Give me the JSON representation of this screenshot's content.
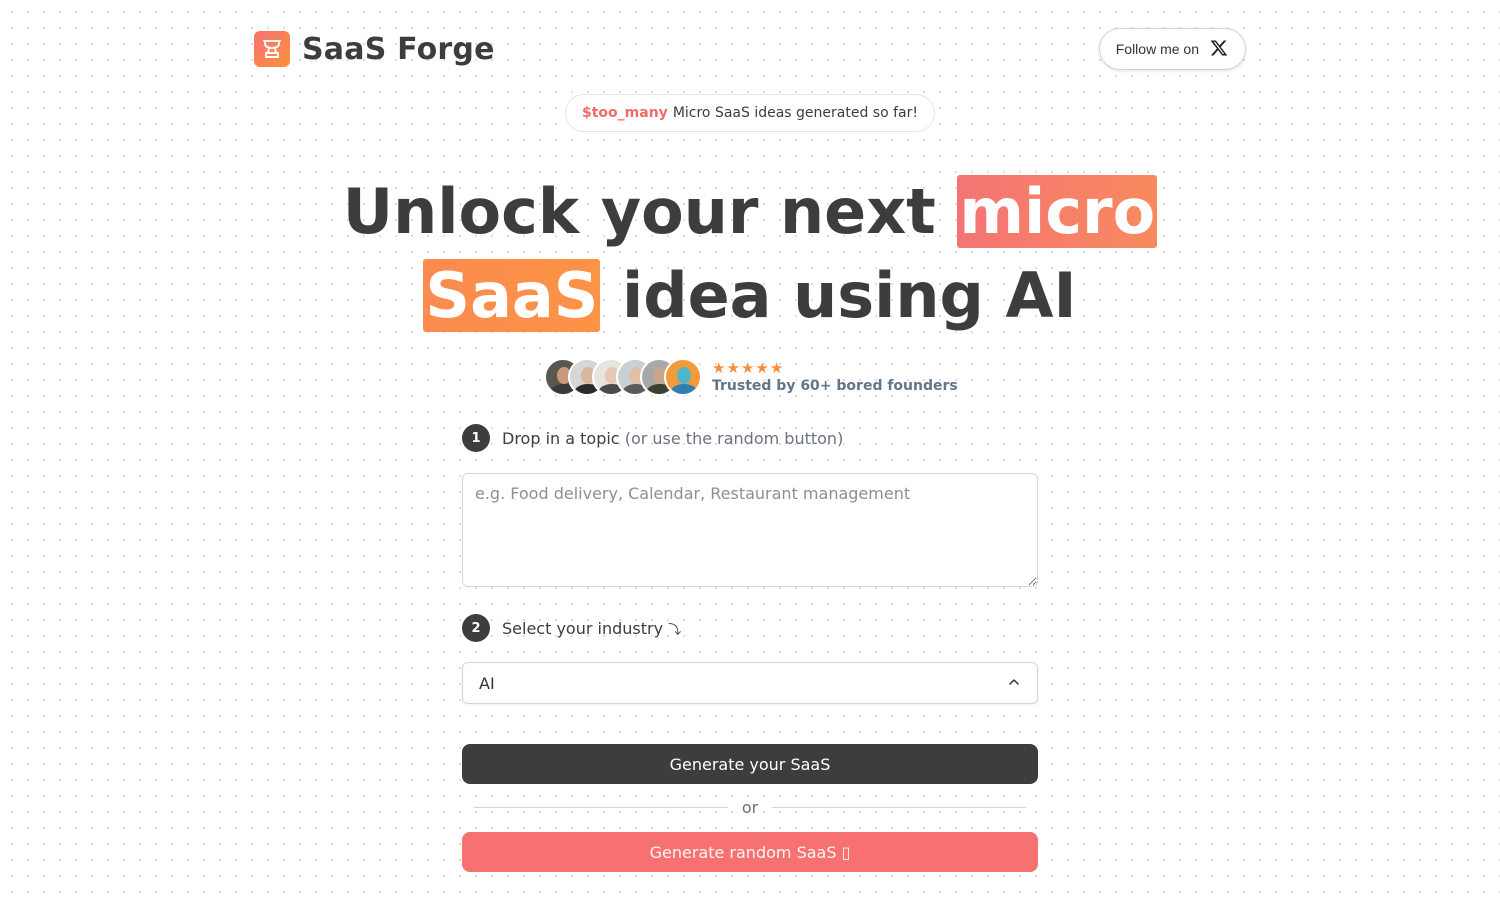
{
  "header": {
    "brand_name": "SaaS Forge",
    "logo_icon": "trophy-icon",
    "follow_label": "Follow me on",
    "follow_icon": "x-logo-icon"
  },
  "counter": {
    "variable": "$too_many",
    "text": "Micro SaaS ideas generated so far!"
  },
  "hero": {
    "part1": "Unlock your next",
    "highlight1": "micro",
    "highlight2": "SaaS",
    "part2": "idea using AI"
  },
  "social_proof": {
    "avatars": [
      {
        "name": "avatar-1",
        "skin": "#c89b7b",
        "shirt": "#3a3a3a",
        "bg": "#5a5650"
      },
      {
        "name": "avatar-2",
        "skin": "#d9b6a0",
        "shirt": "#2b2b2b",
        "bg": "#d6d6d6"
      },
      {
        "name": "avatar-3",
        "skin": "#e6c8b4",
        "shirt": "#4a4a4a",
        "bg": "#e8e4e0"
      },
      {
        "name": "avatar-4",
        "skin": "#e2bfa8",
        "shirt": "#5b5b5b",
        "bg": "#c8d0d6"
      },
      {
        "name": "avatar-5",
        "skin": "#caa58c",
        "shirt": "#3c3f32",
        "bg": "#a8a8a8"
      },
      {
        "name": "avatar-6",
        "skin": "#4fb6c9",
        "shirt": "#2f7fb0",
        "bg": "#f39a3b"
      }
    ],
    "rating": 5,
    "rating_max": 5,
    "star_color": "#fb8c3c",
    "trusted_text": "Trusted by 60+ bored founders"
  },
  "step1": {
    "number": "1",
    "label": "Drop in a topic",
    "hint": "(or use the random button)",
    "input_value": "",
    "input_placeholder": "e.g. Food delivery, Calendar, Restaurant management"
  },
  "step2": {
    "number": "2",
    "label": "Select your industry",
    "arrow": "⤵",
    "selected": "AI",
    "chevron_icon": "chevron-up-icon"
  },
  "actions": {
    "generate_label": "Generate your SaaS",
    "divider_text": "or",
    "random_label": "Generate random SaaS",
    "random_emoji": "▯"
  },
  "colors": {
    "primary_dark": "#3d3d3d",
    "accent_coral": "#f87171",
    "accent_orange": "#fb923c",
    "counter_highlight": "#f16b6b"
  }
}
